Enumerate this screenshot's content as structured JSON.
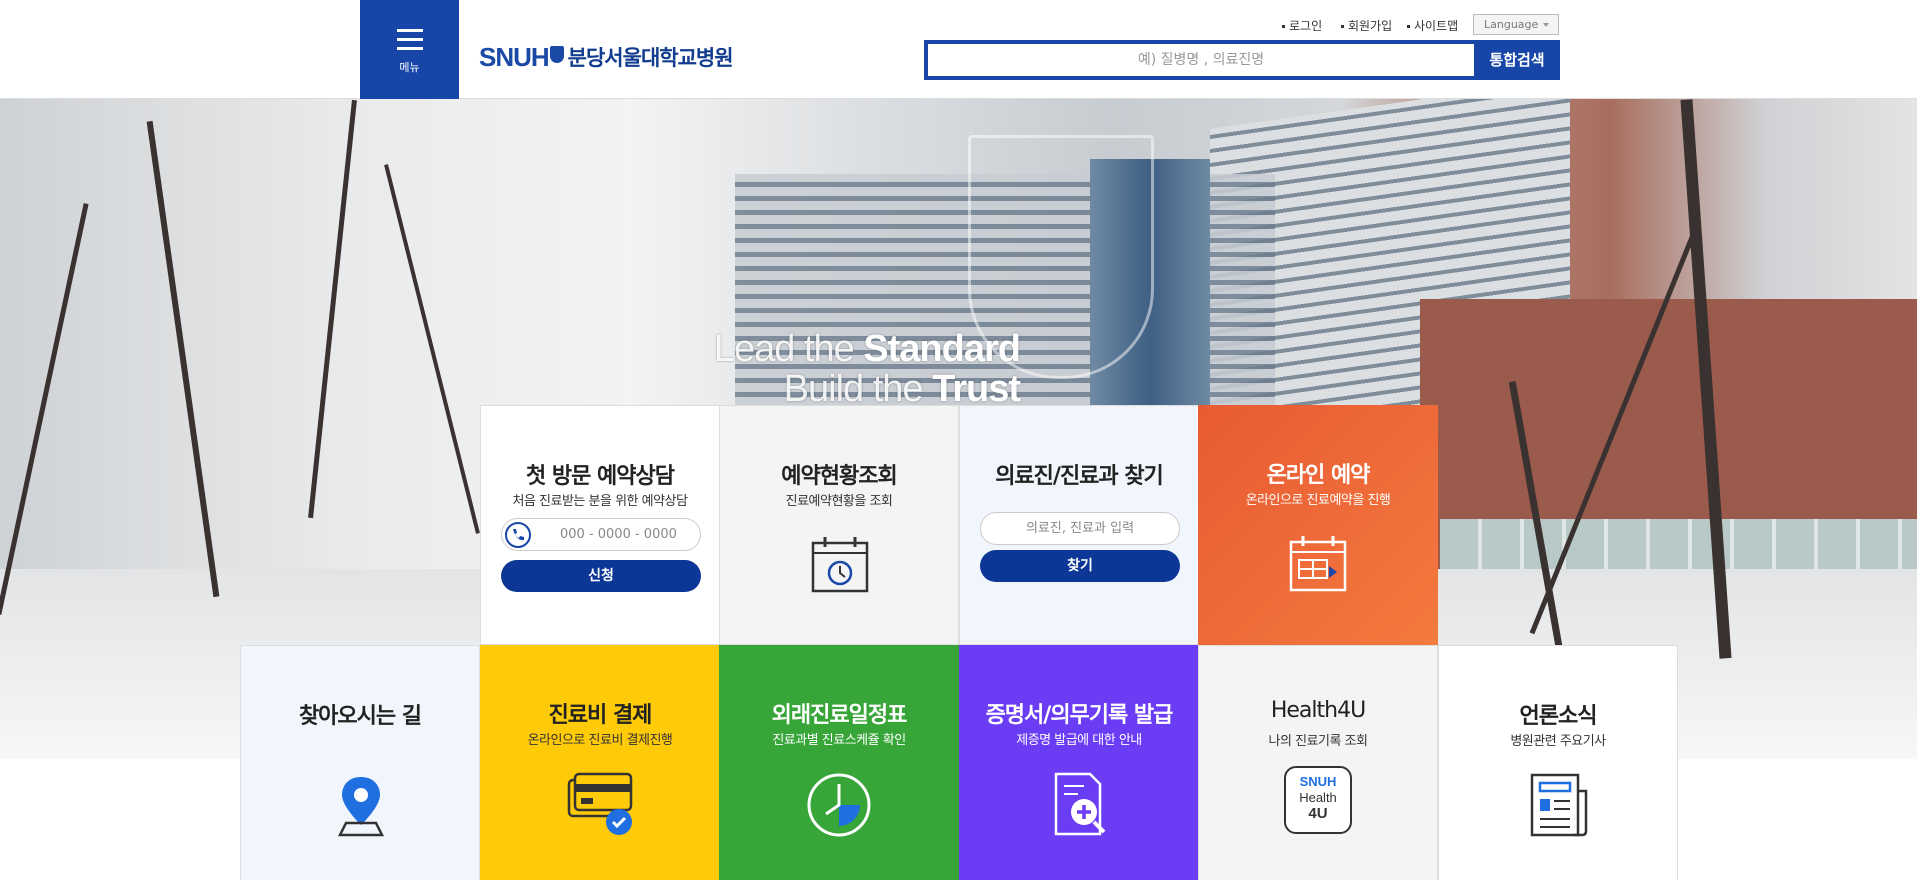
{
  "header": {
    "menu_label": "메뉴",
    "logo_brand": "SNUH",
    "logo_name": "분당서울대학교병원",
    "util_links": [
      "로그인",
      "회원가입",
      "사이트맵"
    ],
    "language_label": "Language",
    "search_placeholder": "예) 질병명 , 의료진명",
    "search_button": "통합검색"
  },
  "hero": {
    "slogan_line1_thin": "Lead the ",
    "slogan_line1_bold": "Standard",
    "slogan_line2_thin": "Build the ",
    "slogan_line2_bold": "Trust"
  },
  "tiles_row1": [
    {
      "title": "첫 방문 예약상담",
      "subtitle": "처음 진료받는 분을 위한 예약상담",
      "input_placeholder": "000 - 0000 - 0000",
      "button": "신청",
      "icon": "phone-icon"
    },
    {
      "title": "예약현황조회",
      "subtitle": "진료예약현황을 조회",
      "icon": "calendar-clock-icon"
    },
    {
      "title": "의료진/진료과 찾기",
      "subtitle": "",
      "input_placeholder": "의료진, 진료과 입력",
      "button": "찾기"
    },
    {
      "title": "온라인 예약",
      "subtitle": "온라인으로 진료예약을 진행",
      "icon": "calendar-icon"
    }
  ],
  "tiles_row2": [
    {
      "title": "찾아오시는 길",
      "subtitle": "",
      "icon": "map-pin-icon"
    },
    {
      "title": "진료비 결제",
      "subtitle": "온라인으로 진료비 결제진행",
      "icon": "credit-card-icon"
    },
    {
      "title": "외래진료일정표",
      "subtitle": "진료과별 진료스케쥴 확인",
      "icon": "clock-icon"
    },
    {
      "title": "증명서/의무기록 발급",
      "subtitle": "제증명 발급에 대한 안내",
      "icon": "document-search-icon"
    },
    {
      "title": "Health4U",
      "subtitle": "나의 진료기록 조회",
      "icon": "health4u-icon",
      "icon_text": [
        "SNUH",
        "Health",
        "4U"
      ]
    },
    {
      "title": "언론소식",
      "subtitle": "병원관련 주요기사",
      "icon": "newspaper-icon"
    }
  ],
  "colors": {
    "brand": "#1846a8",
    "button_navy": "#0c3796",
    "orange": "#e85a33",
    "yellow": "#ffca08",
    "green": "#37a538",
    "purple": "#6a3cf4"
  }
}
